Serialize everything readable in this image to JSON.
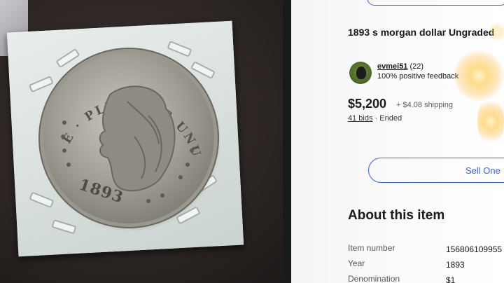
{
  "coin": {
    "legend": "E · PLURIBUS UNUM",
    "date": "1893"
  },
  "listing": {
    "title": "1893 s morgan dollar Ungraded",
    "seller": {
      "username": "evmei51",
      "rating_count": "(22)",
      "feedback": "100% positive feedback"
    },
    "price": "$5,200",
    "shipping": "+ $4.08 shipping",
    "bids_link": "41 bids",
    "separator": "·",
    "status": "Ended",
    "sell_button_label": "Sell One",
    "about_heading": "About this item",
    "specifics": [
      {
        "label": "Item number",
        "value": "156806109955"
      },
      {
        "label": "Year",
        "value": "1893"
      },
      {
        "label": "Denomination",
        "value": "$1"
      }
    ]
  },
  "colors": {
    "accent": "#3665f3",
    "text": "#191919"
  }
}
